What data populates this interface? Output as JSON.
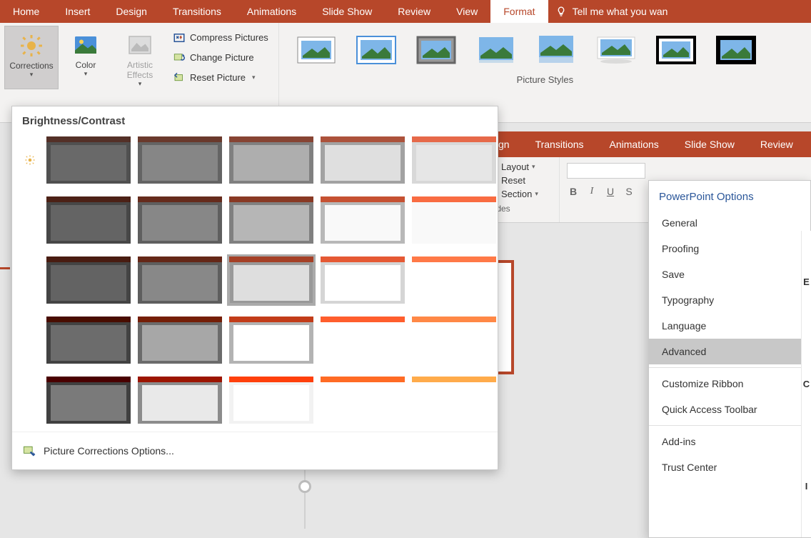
{
  "ribbon_tabs": [
    "Home",
    "Insert",
    "Design",
    "Transitions",
    "Animations",
    "Slide Show",
    "Review",
    "View",
    "Format"
  ],
  "tell_me": "Tell me what you wan",
  "corrections": {
    "label": "Corrections"
  },
  "color": {
    "label": "Color"
  },
  "artistic": {
    "label": "Artistic Effects"
  },
  "adjust": {
    "compress": "Compress Pictures",
    "change": "Change Picture",
    "reset": "Reset Picture"
  },
  "picture_styles_label": "Picture Styles",
  "dropdown": {
    "header": "Brightness/Contrast",
    "footer": "Picture Corrections Options..."
  },
  "secondary_tabs": [
    "gn",
    "Transitions",
    "Animations",
    "Slide Show",
    "Review"
  ],
  "slide_tools": {
    "layout": "Layout",
    "reset": "Reset",
    "section": "Section",
    "slides": "lides"
  },
  "font_buttons": [
    "B",
    "I",
    "U",
    "S"
  ],
  "options": {
    "title": "PowerPoint Options",
    "items_top": [
      "General",
      "Proofing",
      "Save",
      "Typography",
      "Language",
      "Advanced"
    ],
    "items_bottom": [
      "Customize Ribbon",
      "Quick Access Toolbar"
    ],
    "items_last": [
      "Add-ins",
      "Trust Center"
    ],
    "selected": "Advanced",
    "right_letters": [
      "E",
      "C",
      "I"
    ]
  }
}
